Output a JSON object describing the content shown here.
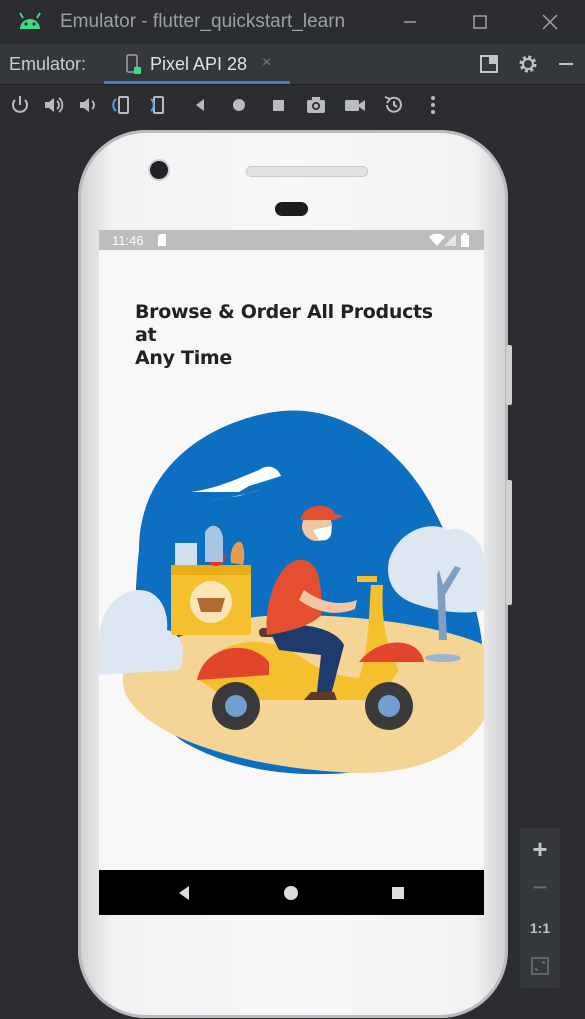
{
  "window": {
    "title": "Emulator - flutter_quickstart_learn"
  },
  "tabbar": {
    "label": "Emulator:",
    "tab_label": "Pixel API 28",
    "tab_close": "×"
  },
  "status": {
    "time": "11:46"
  },
  "app": {
    "headline_line1": "Browse & Order All Products at",
    "headline_line2": "Any Time"
  },
  "zoom": {
    "plus": "+",
    "minus": "−",
    "ratio": "1:1"
  },
  "colors": {
    "accent": "#3d7fd9",
    "blob_blue": "#0d6fbf",
    "scooter_yellow": "#f5c02e",
    "scooter_red": "#e1452c"
  }
}
